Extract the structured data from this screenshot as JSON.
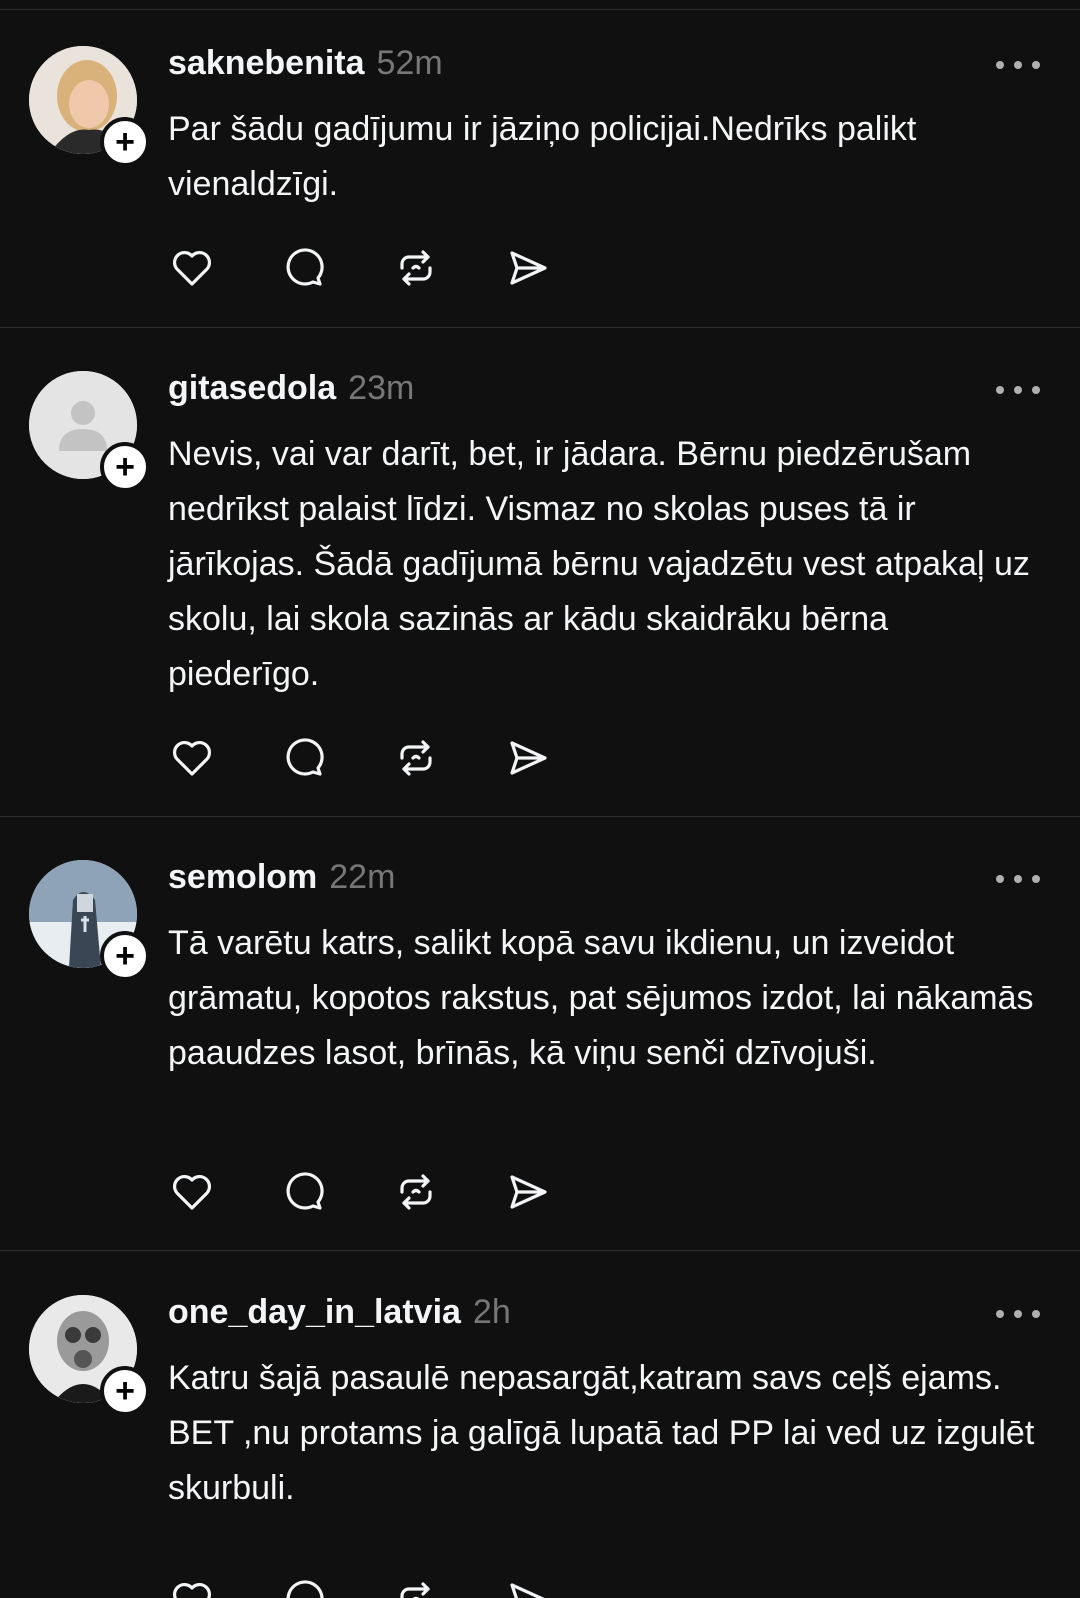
{
  "posts": [
    {
      "username": "saknebenita",
      "time": "52m",
      "text": "Par šādu gadījumu ir jāziņo policijai.Nedrīks palikt vienaldzīgi.",
      "avatar": "photo-woman-blonde"
    },
    {
      "username": "gitasedola",
      "time": "23m",
      "text": "Nevis, vai var darīt, bet, ir jādara. Bērnu piedzērušam nedrīkst palaist līdzi. Vismaz no skolas puses tā ir jārīkojas. Šādā gadījumā bērnu vajadzētu vest atpakaļ uz skolu, lai skola sazinās ar kādu skaidrāku bērna piederīgo.",
      "avatar": "default-person-icon"
    },
    {
      "username": "semolom",
      "time": "22m",
      "text": "Tā varētu katrs, salikt kopā savu ikdienu, un izveidot grāmatu, kopotos rakstus, pat sējumos izdot, lai nākamās paaudzes lasot, brīnās, kā viņu senči dzīvojuši.",
      "avatar": "image-knight-snow"
    },
    {
      "username": "one_day_in_latvia",
      "time": "2h",
      "text": "Katru šajā pasaulē nepasargāt,katram savs ceļš ejams. BET ,nu protams ja galīgā lupatā tad PP lai ved uz izgulēt skurbuli.",
      "avatar": "image-gas-mask"
    }
  ],
  "icons": {
    "like": "heart-icon",
    "reply": "comment-icon",
    "repost": "repost-icon",
    "share": "send-icon",
    "more": "more-dots-icon",
    "follow": "plus-icon"
  },
  "follow_symbol": "+",
  "colors": {
    "background": "#101010",
    "text": "#f3f5f7",
    "muted": "#777777",
    "divider": "#2e2e2e"
  }
}
